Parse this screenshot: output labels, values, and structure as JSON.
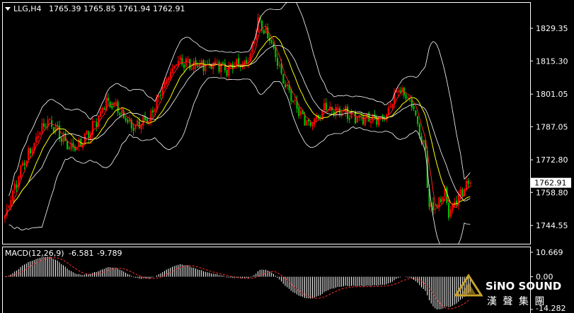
{
  "main": {
    "symbol_label": "LLG,H4",
    "ohlc": [
      "1765.39",
      "1765.85",
      "1761.94",
      "1762.91"
    ],
    "current_price": "1762.91"
  },
  "macd": {
    "label": "MACD(12,26,9)",
    "macd_value": "-6.581",
    "signal_value": "-9.789"
  },
  "logo": {
    "en": "SiNO SOUND",
    "cn": "漢 聲 集 團"
  },
  "colors": {
    "bull": "#ff0000",
    "bear": "#00c000",
    "bb": "#ffffff",
    "ma_fast": "#ff2020",
    "ma_slow": "#ffff00",
    "signal": "#ff3030",
    "histogram": "#ffffff",
    "background": "#000000",
    "axis_text": "#ffffff"
  },
  "chart_data": [
    {
      "type": "candlestick",
      "title": "LLG,H4",
      "ylim": [
        1737.0,
        1840.0
      ],
      "y_ticks": [
        1829.35,
        1815.3,
        1801.05,
        1787.05,
        1772.8,
        1758.8,
        1744.55
      ],
      "current_price": 1762.91,
      "anchors": [
        [
          0,
          1748
        ],
        [
          8,
          1768
        ],
        [
          16,
          1782
        ],
        [
          22,
          1790
        ],
        [
          28,
          1783
        ],
        [
          36,
          1777
        ],
        [
          44,
          1785
        ],
        [
          52,
          1798
        ],
        [
          58,
          1795
        ],
        [
          66,
          1787
        ],
        [
          74,
          1790
        ],
        [
          80,
          1802
        ],
        [
          88,
          1815
        ],
        [
          98,
          1813
        ],
        [
          108,
          1814
        ],
        [
          114,
          1812
        ],
        [
          120,
          1813
        ],
        [
          126,
          1817
        ],
        [
          130,
          1832
        ],
        [
          136,
          1825
        ],
        [
          142,
          1810
        ],
        [
          148,
          1797
        ],
        [
          156,
          1788
        ],
        [
          164,
          1795
        ],
        [
          172,
          1794
        ],
        [
          180,
          1791
        ],
        [
          188,
          1790
        ],
        [
          196,
          1792
        ],
        [
          202,
          1804
        ],
        [
          210,
          1795
        ],
        [
          216,
          1775
        ],
        [
          218,
          1753
        ],
        [
          222,
          1752
        ],
        [
          226,
          1758
        ],
        [
          228,
          1749
        ],
        [
          233,
          1757
        ],
        [
          239,
          1764
        ]
      ],
      "series": [
        {
          "name": "Bollinger Bands (upper/middle/lower)"
        },
        {
          "name": "MA fast"
        },
        {
          "name": "MA slow"
        }
      ]
    },
    {
      "type": "bar",
      "title": "MACD(12,26,9)",
      "ylim": [
        -14.282,
        10.669
      ],
      "y_ticks": [
        10.669,
        0.0,
        -14.282
      ],
      "macd": -6.581,
      "signal": -9.789
    }
  ]
}
